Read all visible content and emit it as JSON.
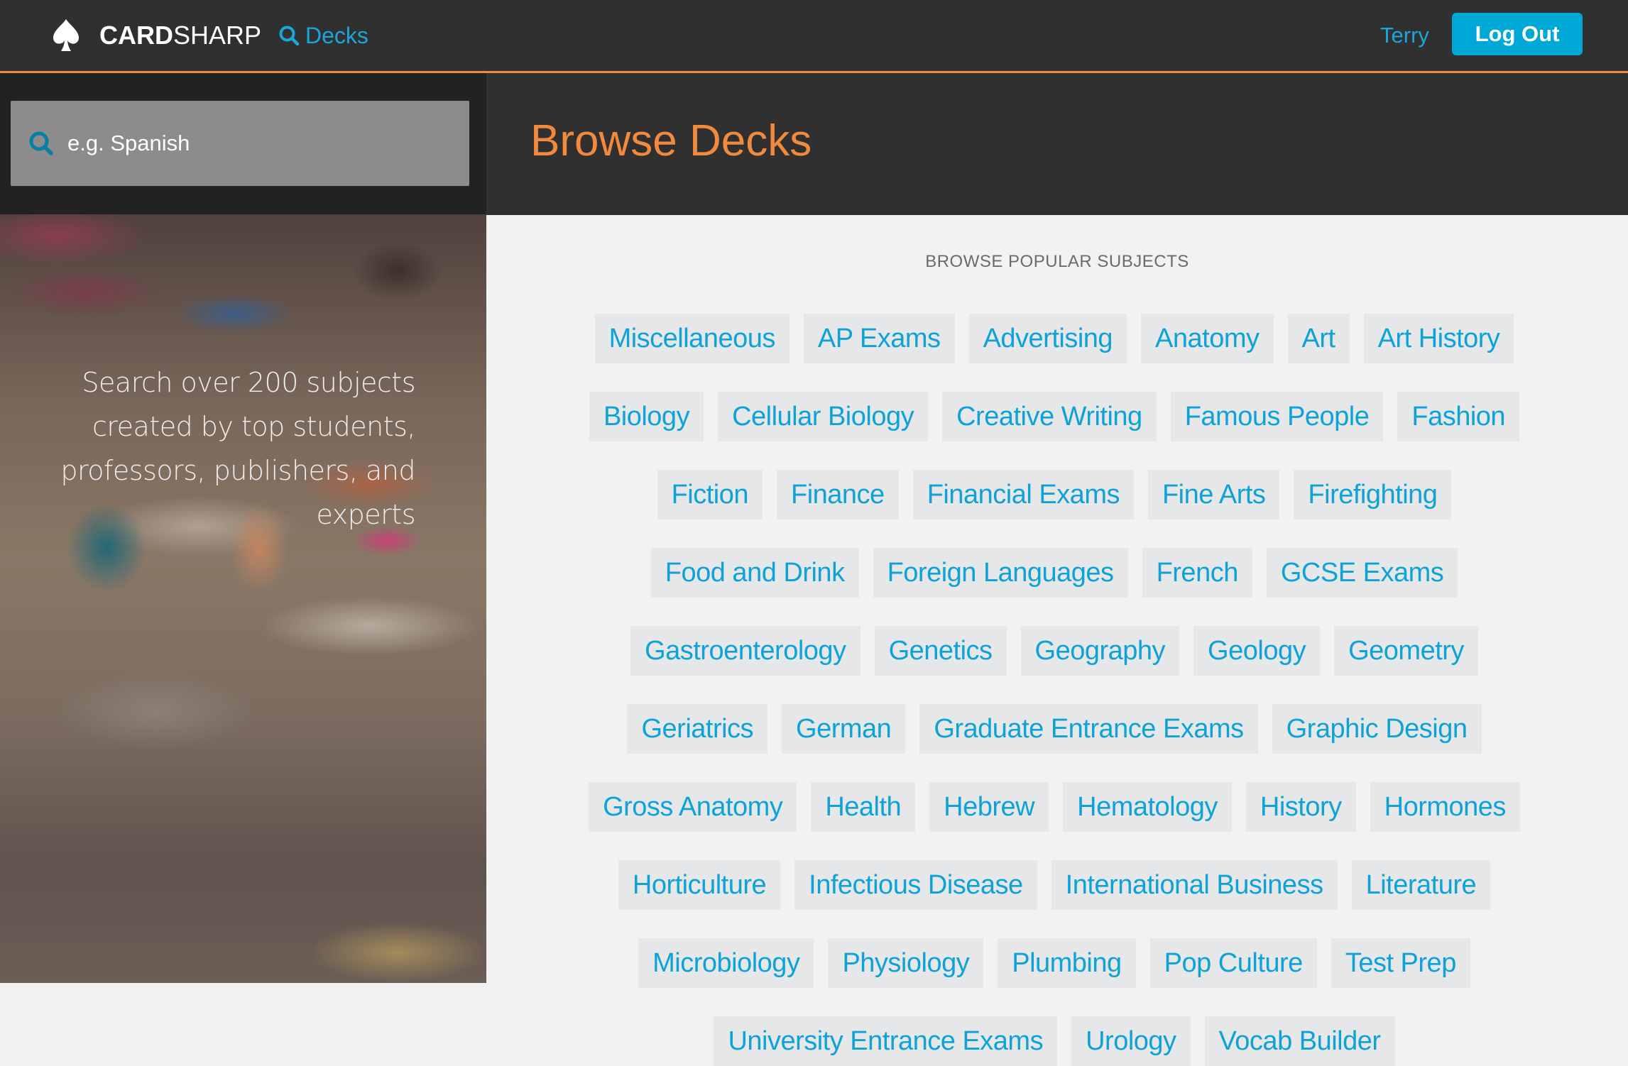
{
  "header": {
    "brand_bold": "CARD",
    "brand_light": "SHARP",
    "brand_icon": "spade-icon",
    "nav_decks_label": "Decks",
    "nav_decks_icon": "search-icon",
    "user_name": "Terry",
    "logout_label": "Log Out"
  },
  "sidebar": {
    "search": {
      "placeholder": "e.g. Spanish",
      "value": "",
      "icon": "search-icon"
    },
    "tagline": "Search over 200 subjects created by top students, professors, publishers, and experts"
  },
  "main": {
    "title": "Browse Decks",
    "section_label": "BROWSE POPULAR SUBJECTS",
    "subject_rows": [
      [
        "Miscellaneous",
        "AP Exams",
        "Advertising",
        "Anatomy",
        "Art",
        "Art History"
      ],
      [
        "Biology",
        "Cellular Biology",
        "Creative Writing",
        "Famous People",
        "Fashion"
      ],
      [
        "Fiction",
        "Finance",
        "Financial Exams",
        "Fine Arts",
        "Firefighting"
      ],
      [
        "Food and Drink",
        "Foreign Languages",
        "French",
        "GCSE Exams"
      ],
      [
        "Gastroenterology",
        "Genetics",
        "Geography",
        "Geology",
        "Geometry"
      ],
      [
        "Geriatrics",
        "German",
        "Graduate Entrance Exams",
        "Graphic Design"
      ],
      [
        "Gross Anatomy",
        "Health",
        "Hebrew",
        "Hematology",
        "History",
        "Hormones"
      ],
      [
        "Horticulture",
        "Infectious Disease",
        "International Business",
        "Literature"
      ],
      [
        "Microbiology",
        "Physiology",
        "Plumbing",
        "Pop Culture",
        "Test Prep"
      ],
      [
        "University Entrance Exams",
        "Urology",
        "Vocab Builder"
      ]
    ]
  },
  "colors": {
    "accent_orange": "#f28a3e",
    "link_blue": "#0fa2d6",
    "button_blue": "#00a8d8",
    "header_bg": "#303030",
    "sidebar_bg": "#222222",
    "tag_bg": "#e6e7e8",
    "page_bg": "#f2f2f2"
  }
}
